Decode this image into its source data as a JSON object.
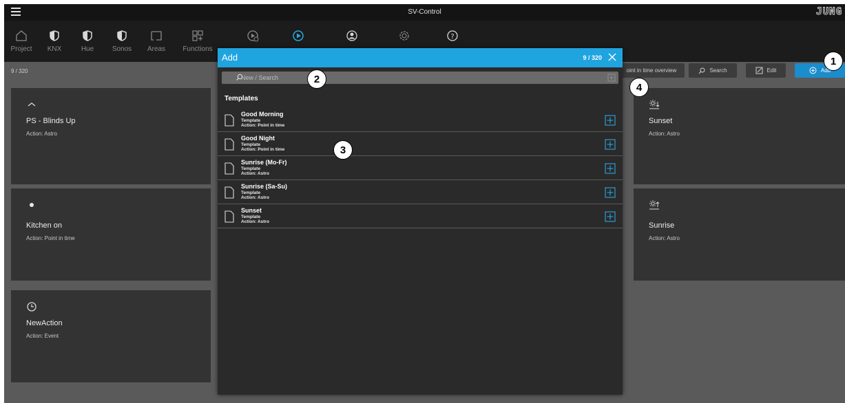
{
  "app": {
    "title": "SV-Control",
    "logo": "JUNG"
  },
  "nav": {
    "items": [
      {
        "label": "Project",
        "icon": "house-icon"
      },
      {
        "label": "KNX",
        "icon": "shield-half-icon"
      },
      {
        "label": "Hue",
        "icon": "shield-half-icon"
      },
      {
        "label": "Sonos",
        "icon": "shield-half-icon"
      },
      {
        "label": "Areas",
        "icon": "areas-icon"
      },
      {
        "label": "Functions",
        "icon": "functions-icon"
      },
      {
        "label": "",
        "icon": "timer-play-icon"
      },
      {
        "label": "",
        "icon": "play-circle-icon"
      },
      {
        "label": "",
        "icon": "user-circle-icon"
      },
      {
        "label": "",
        "icon": "gear-icon"
      },
      {
        "label": "",
        "icon": "help-icon"
      }
    ]
  },
  "toolbar": {
    "count": "9 / 320",
    "overview_label": "oint in time overview",
    "search_label": "Search",
    "edit_label": "Edit",
    "add_label": "Add"
  },
  "cards": [
    {
      "title": "PS - Blinds Up",
      "subtitle": "Action: Astro",
      "icon": "chevron-up-icon"
    },
    {
      "title": "Sunset",
      "subtitle": "Action: Astro",
      "icon": "sunset-icon"
    },
    {
      "title": "Kitchen on",
      "subtitle": "Action: Point in time",
      "icon": "dot-icon"
    },
    {
      "title": "Sunrise",
      "subtitle": "Action: Astro",
      "icon": "sunrise-icon"
    },
    {
      "title": "NewAction",
      "subtitle": "Action: Event",
      "icon": "clock-icon"
    }
  ],
  "modal": {
    "title": "Add",
    "count": "9 / 320",
    "search_placeholder": "New / Search",
    "section_title": "Templates",
    "templates": [
      {
        "name": "Good Morning",
        "type": "Template",
        "action": "Action: Point in time"
      },
      {
        "name": "Good Night",
        "type": "Template",
        "action": "Action: Point in time"
      },
      {
        "name": "Sunrise (Mo-Fr)",
        "type": "Template",
        "action": "Action: Astro"
      },
      {
        "name": "Sunrise (Sa-Su)",
        "type": "Template",
        "action": "Action: Astro"
      },
      {
        "name": "Sunset",
        "type": "Template",
        "action": "Action: Astro"
      }
    ]
  },
  "callouts": [
    "1",
    "2",
    "3",
    "4"
  ],
  "colors": {
    "accent": "#1fa4e0",
    "background": "#5a5a5a",
    "card": "#333333",
    "modal": "#2a2a2a"
  }
}
